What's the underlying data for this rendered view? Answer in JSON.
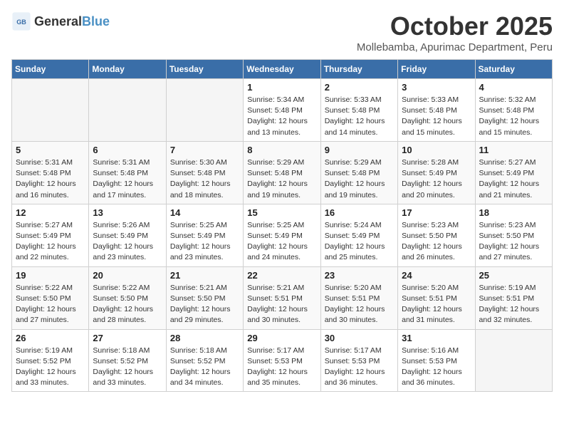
{
  "header": {
    "logo_general": "General",
    "logo_blue": "Blue",
    "month": "October 2025",
    "location": "Mollebamba, Apurimac Department, Peru"
  },
  "weekdays": [
    "Sunday",
    "Monday",
    "Tuesday",
    "Wednesday",
    "Thursday",
    "Friday",
    "Saturday"
  ],
  "weeks": [
    [
      {
        "day": "",
        "info": ""
      },
      {
        "day": "",
        "info": ""
      },
      {
        "day": "",
        "info": ""
      },
      {
        "day": "1",
        "info": "Sunrise: 5:34 AM\nSunset: 5:48 PM\nDaylight: 12 hours\nand 13 minutes."
      },
      {
        "day": "2",
        "info": "Sunrise: 5:33 AM\nSunset: 5:48 PM\nDaylight: 12 hours\nand 14 minutes."
      },
      {
        "day": "3",
        "info": "Sunrise: 5:33 AM\nSunset: 5:48 PM\nDaylight: 12 hours\nand 15 minutes."
      },
      {
        "day": "4",
        "info": "Sunrise: 5:32 AM\nSunset: 5:48 PM\nDaylight: 12 hours\nand 15 minutes."
      }
    ],
    [
      {
        "day": "5",
        "info": "Sunrise: 5:31 AM\nSunset: 5:48 PM\nDaylight: 12 hours\nand 16 minutes."
      },
      {
        "day": "6",
        "info": "Sunrise: 5:31 AM\nSunset: 5:48 PM\nDaylight: 12 hours\nand 17 minutes."
      },
      {
        "day": "7",
        "info": "Sunrise: 5:30 AM\nSunset: 5:48 PM\nDaylight: 12 hours\nand 18 minutes."
      },
      {
        "day": "8",
        "info": "Sunrise: 5:29 AM\nSunset: 5:48 PM\nDaylight: 12 hours\nand 19 minutes."
      },
      {
        "day": "9",
        "info": "Sunrise: 5:29 AM\nSunset: 5:48 PM\nDaylight: 12 hours\nand 19 minutes."
      },
      {
        "day": "10",
        "info": "Sunrise: 5:28 AM\nSunset: 5:49 PM\nDaylight: 12 hours\nand 20 minutes."
      },
      {
        "day": "11",
        "info": "Sunrise: 5:27 AM\nSunset: 5:49 PM\nDaylight: 12 hours\nand 21 minutes."
      }
    ],
    [
      {
        "day": "12",
        "info": "Sunrise: 5:27 AM\nSunset: 5:49 PM\nDaylight: 12 hours\nand 22 minutes."
      },
      {
        "day": "13",
        "info": "Sunrise: 5:26 AM\nSunset: 5:49 PM\nDaylight: 12 hours\nand 23 minutes."
      },
      {
        "day": "14",
        "info": "Sunrise: 5:25 AM\nSunset: 5:49 PM\nDaylight: 12 hours\nand 23 minutes."
      },
      {
        "day": "15",
        "info": "Sunrise: 5:25 AM\nSunset: 5:49 PM\nDaylight: 12 hours\nand 24 minutes."
      },
      {
        "day": "16",
        "info": "Sunrise: 5:24 AM\nSunset: 5:49 PM\nDaylight: 12 hours\nand 25 minutes."
      },
      {
        "day": "17",
        "info": "Sunrise: 5:23 AM\nSunset: 5:50 PM\nDaylight: 12 hours\nand 26 minutes."
      },
      {
        "day": "18",
        "info": "Sunrise: 5:23 AM\nSunset: 5:50 PM\nDaylight: 12 hours\nand 27 minutes."
      }
    ],
    [
      {
        "day": "19",
        "info": "Sunrise: 5:22 AM\nSunset: 5:50 PM\nDaylight: 12 hours\nand 27 minutes."
      },
      {
        "day": "20",
        "info": "Sunrise: 5:22 AM\nSunset: 5:50 PM\nDaylight: 12 hours\nand 28 minutes."
      },
      {
        "day": "21",
        "info": "Sunrise: 5:21 AM\nSunset: 5:50 PM\nDaylight: 12 hours\nand 29 minutes."
      },
      {
        "day": "22",
        "info": "Sunrise: 5:21 AM\nSunset: 5:51 PM\nDaylight: 12 hours\nand 30 minutes."
      },
      {
        "day": "23",
        "info": "Sunrise: 5:20 AM\nSunset: 5:51 PM\nDaylight: 12 hours\nand 30 minutes."
      },
      {
        "day": "24",
        "info": "Sunrise: 5:20 AM\nSunset: 5:51 PM\nDaylight: 12 hours\nand 31 minutes."
      },
      {
        "day": "25",
        "info": "Sunrise: 5:19 AM\nSunset: 5:51 PM\nDaylight: 12 hours\nand 32 minutes."
      }
    ],
    [
      {
        "day": "26",
        "info": "Sunrise: 5:19 AM\nSunset: 5:52 PM\nDaylight: 12 hours\nand 33 minutes."
      },
      {
        "day": "27",
        "info": "Sunrise: 5:18 AM\nSunset: 5:52 PM\nDaylight: 12 hours\nand 33 minutes."
      },
      {
        "day": "28",
        "info": "Sunrise: 5:18 AM\nSunset: 5:52 PM\nDaylight: 12 hours\nand 34 minutes."
      },
      {
        "day": "29",
        "info": "Sunrise: 5:17 AM\nSunset: 5:53 PM\nDaylight: 12 hours\nand 35 minutes."
      },
      {
        "day": "30",
        "info": "Sunrise: 5:17 AM\nSunset: 5:53 PM\nDaylight: 12 hours\nand 36 minutes."
      },
      {
        "day": "31",
        "info": "Sunrise: 5:16 AM\nSunset: 5:53 PM\nDaylight: 12 hours\nand 36 minutes."
      },
      {
        "day": "",
        "info": ""
      }
    ]
  ]
}
